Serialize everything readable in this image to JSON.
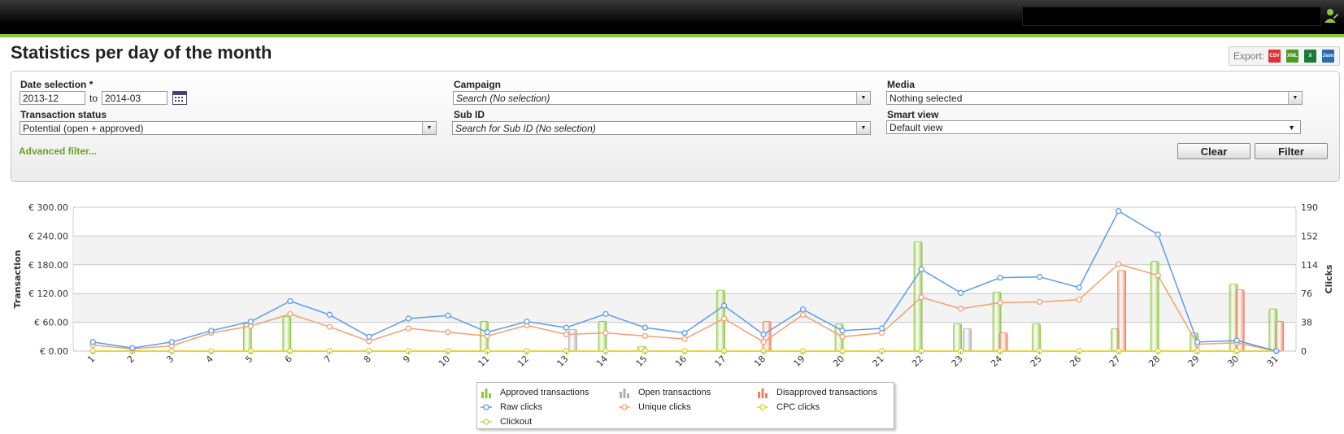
{
  "page": {
    "title": "Statistics per day of the month"
  },
  "export": {
    "label": "Export:",
    "formats": [
      "CSV",
      "XML",
      "X",
      "Json"
    ]
  },
  "filters": {
    "date_selection": {
      "label": "Date selection *",
      "from": "2013-12",
      "to_label": "to",
      "to": "2014-03"
    },
    "campaign": {
      "label": "Campaign",
      "value": "Search (No selection)"
    },
    "media": {
      "label": "Media",
      "value": "Nothing selected"
    },
    "transaction_status": {
      "label": "Transaction status",
      "value": "Potential (open + approved)"
    },
    "sub_id": {
      "label": "Sub ID",
      "value": "Search for Sub ID (No selection)"
    },
    "smart_view": {
      "label": "Smart view",
      "value": "Default view"
    },
    "advanced_filter": "Advanced filter...",
    "clear_label": "Clear",
    "filter_label": "Filter"
  },
  "colors": {
    "accent": "#8dc63f",
    "approved": "#8dc63f",
    "open": "#b0b0b0",
    "disapproved": "#f08060",
    "raw": "#5b9bf0",
    "unique": "#f4a070",
    "cpc": "#e6d020",
    "clickout": "#b8d84a"
  },
  "chart_data": {
    "type": "bar",
    "categories": [
      "1",
      "2",
      "3",
      "4",
      "5",
      "6",
      "7",
      "8",
      "9",
      "10",
      "11",
      "12",
      "13",
      "14",
      "15",
      "16",
      "17",
      "18",
      "19",
      "20",
      "21",
      "22",
      "23",
      "24",
      "25",
      "26",
      "27",
      "28",
      "29",
      "30",
      "31"
    ],
    "y_left": {
      "label": "Transaction",
      "ticks": [
        "€ 0.00",
        "€ 60.00",
        "€ 120.00",
        "€ 180.00",
        "€ 240.00",
        "€ 300.00"
      ],
      "range": [
        0,
        300
      ]
    },
    "y_right": {
      "label": "Clicks",
      "ticks": [
        "0",
        "38",
        "76",
        "114",
        "152",
        "190"
      ],
      "range": [
        0,
        190
      ]
    },
    "series": [
      {
        "name": "Approved transactions",
        "kind": "bar",
        "axis": "left",
        "values": [
          0,
          0,
          0,
          0,
          57,
          72,
          0,
          0,
          0,
          0,
          62,
          0,
          0,
          62,
          10,
          0,
          127,
          0,
          0,
          57,
          0,
          228,
          57,
          123,
          57,
          0,
          47,
          187,
          38,
          140,
          88
        ]
      },
      {
        "name": "Open transactions",
        "kind": "bar",
        "axis": "left",
        "values": [
          0,
          0,
          0,
          0,
          0,
          0,
          0,
          0,
          0,
          0,
          0,
          0,
          45,
          0,
          0,
          0,
          0,
          0,
          0,
          0,
          0,
          0,
          47,
          0,
          0,
          0,
          0,
          0,
          0,
          0,
          0
        ]
      },
      {
        "name": "Disapproved transactions",
        "kind": "bar",
        "axis": "left",
        "values": [
          0,
          0,
          0,
          0,
          0,
          0,
          0,
          0,
          0,
          0,
          0,
          0,
          0,
          0,
          0,
          0,
          0,
          62,
          0,
          0,
          0,
          0,
          0,
          38,
          0,
          0,
          168,
          0,
          0,
          128,
          62
        ]
      },
      {
        "name": "Raw clicks",
        "kind": "line",
        "axis": "right",
        "values": [
          12,
          4,
          12,
          27,
          39,
          66,
          48,
          19,
          43,
          47,
          25,
          39,
          31,
          49,
          31,
          24,
          60,
          22,
          55,
          27,
          30,
          108,
          77,
          97,
          98,
          84,
          185,
          154,
          12,
          14,
          0
        ]
      },
      {
        "name": "Unique clicks",
        "kind": "line",
        "axis": "right",
        "values": [
          8,
          3,
          7,
          24,
          33,
          49,
          32,
          13,
          30,
          25,
          20,
          34,
          22,
          24,
          20,
          16,
          43,
          12,
          48,
          19,
          24,
          71,
          56,
          64,
          65,
          68,
          115,
          100,
          9,
          11,
          0
        ]
      },
      {
        "name": "CPC clicks",
        "kind": "line",
        "axis": "right",
        "values": [
          0,
          0,
          0,
          0,
          0,
          0,
          0,
          0,
          0,
          0,
          0,
          0,
          0,
          0,
          0,
          0,
          0,
          0,
          0,
          0,
          0,
          0,
          0,
          0,
          0,
          0,
          0,
          0,
          0,
          0,
          0
        ]
      },
      {
        "name": "Clickout",
        "kind": "line",
        "axis": "right",
        "values": [
          0,
          0,
          0,
          0,
          0,
          0,
          0,
          0,
          0,
          0,
          0,
          0,
          0,
          0,
          0,
          0,
          0,
          0,
          0,
          0,
          0,
          0,
          0,
          0,
          0,
          0,
          0,
          0,
          0,
          0,
          0
        ]
      }
    ],
    "grid": true,
    "legend": "bottom-center"
  }
}
